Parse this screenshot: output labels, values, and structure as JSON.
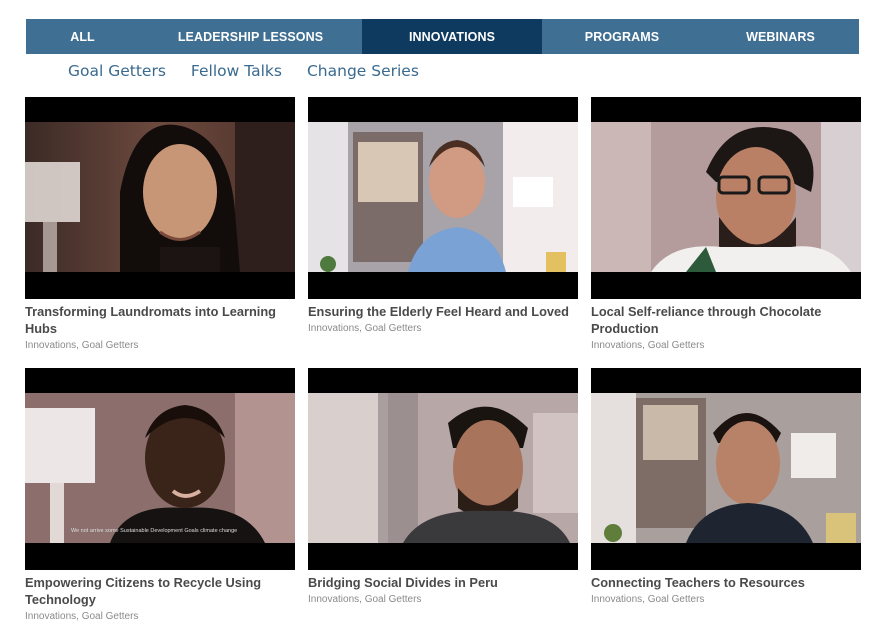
{
  "tabs": [
    {
      "label": "ALL",
      "active": false
    },
    {
      "label": "LEADERSHIP LESSONS",
      "active": false
    },
    {
      "label": "INNOVATIONS",
      "active": true
    },
    {
      "label": "PROGRAMS",
      "active": false
    },
    {
      "label": "WEBINARS",
      "active": false
    }
  ],
  "subnav": [
    "Goal Getters",
    "Fellow Talks",
    "Change Series"
  ],
  "videos": [
    {
      "title": "Transforming Laundromats into Learning Hubs",
      "tags": [
        "Innovations",
        "Goal Getters"
      ]
    },
    {
      "title": "Ensuring the Elderly Feel Heard and Loved",
      "tags": [
        "Innovations",
        "Goal Getters"
      ]
    },
    {
      "title": "Local Self-reliance through Chocolate Production",
      "tags": [
        "Innovations",
        "Goal Getters"
      ]
    },
    {
      "title": "Empowering Citizens to Recycle Using Technology",
      "tags": [
        "Innovations",
        "Goal Getters"
      ],
      "caption": "We not arrive some Sustainable Development Goals climate change"
    },
    {
      "title": "Bridging Social Divides in Peru",
      "tags": [
        "Innovations",
        "Goal Getters"
      ]
    },
    {
      "title": "Connecting Teachers to Resources",
      "tags": [
        "Innovations",
        "Goal Getters"
      ]
    }
  ],
  "colors": {
    "tab_bar": "#3f6f93",
    "tab_active": "#0e3a5f",
    "subnav_link": "#3a6a8f",
    "title": "#4a4a4a",
    "tags": "#8a8a8a"
  }
}
